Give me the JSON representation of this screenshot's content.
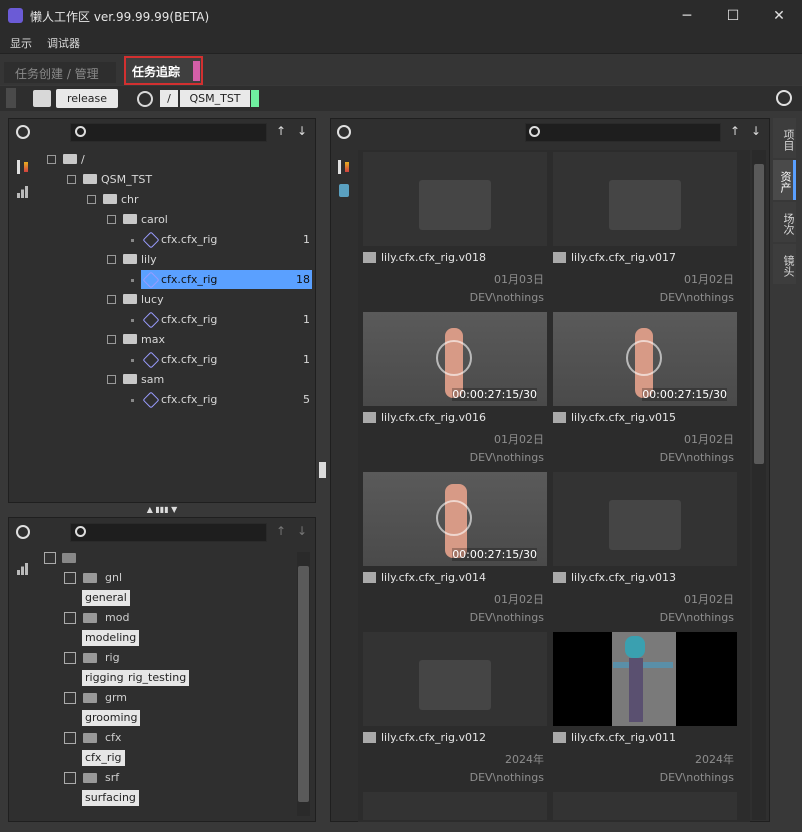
{
  "window": {
    "title": "懒人工作区 ver.99.99.99(BETA)",
    "min": "─",
    "max": "☐",
    "close": "✕"
  },
  "menu": [
    "显示",
    "调试器"
  ],
  "tabs": {
    "create": "任务创建 / 管理",
    "track": "任务追踪"
  },
  "toolbar": {
    "release": "release",
    "path_root": "/",
    "path_project": "QSM_TST"
  },
  "tree": {
    "root": "/",
    "project": "QSM_TST",
    "chr": "chr",
    "items": [
      {
        "name": "carol",
        "rig": "cfx.cfx_rig",
        "count": "1"
      },
      {
        "name": "lily",
        "rig": "cfx.cfx_rig",
        "count": "18"
      },
      {
        "name": "lucy",
        "rig": "cfx.cfx_rig",
        "count": "1"
      },
      {
        "name": "max",
        "rig": "cfx.cfx_rig",
        "count": "1"
      },
      {
        "name": "sam",
        "rig": "cfx.cfx_rig",
        "count": "5"
      }
    ]
  },
  "steps": [
    {
      "name": "gnl",
      "tags": [
        "general"
      ]
    },
    {
      "name": "mod",
      "tags": [
        "modeling"
      ]
    },
    {
      "name": "rig",
      "tags": [
        "rigging",
        "rig_testing"
      ]
    },
    {
      "name": "grm",
      "tags": [
        "grooming"
      ]
    },
    {
      "name": "cfx",
      "tags": [
        "cfx_rig"
      ]
    },
    {
      "name": "srf",
      "tags": [
        "surfacing"
      ]
    }
  ],
  "assets": [
    {
      "name": "lily.cfx.cfx_rig.v018",
      "date": "01月03日",
      "user": "DEV\\nothings",
      "kind": "placeholder"
    },
    {
      "name": "lily.cfx.cfx_rig.v017",
      "date": "01月02日",
      "user": "DEV\\nothings",
      "kind": "placeholder"
    },
    {
      "name": "lily.cfx.cfx_rig.v016",
      "date": "01月02日",
      "user": "DEV\\nothings",
      "kind": "video",
      "duration": "00:00:27:15/30"
    },
    {
      "name": "lily.cfx.cfx_rig.v015",
      "date": "01月02日",
      "user": "DEV\\nothings",
      "kind": "video",
      "duration": "00:00:27:15/30"
    },
    {
      "name": "lily.cfx.cfx_rig.v014",
      "date": "01月02日",
      "user": "DEV\\nothings",
      "kind": "video",
      "duration": "00:00:27:15/30"
    },
    {
      "name": "lily.cfx.cfx_rig.v013",
      "date": "01月02日",
      "user": "DEV\\nothings",
      "kind": "placeholder"
    },
    {
      "name": "lily.cfx.cfx_rig.v012",
      "date": "2024年",
      "user": "DEV\\nothings",
      "kind": "placeholder"
    },
    {
      "name": "lily.cfx.cfx_rig.v011",
      "date": "2024年",
      "user": "DEV\\nothings",
      "kind": "character"
    }
  ],
  "side_tabs": [
    "项目",
    "资产",
    "场次",
    "镜头"
  ],
  "colors": {
    "accent_blue": "#5aa0ff",
    "tab_pink": "#d35fa8",
    "highlight_red": "#d23030",
    "green": "#6ff0a0"
  }
}
